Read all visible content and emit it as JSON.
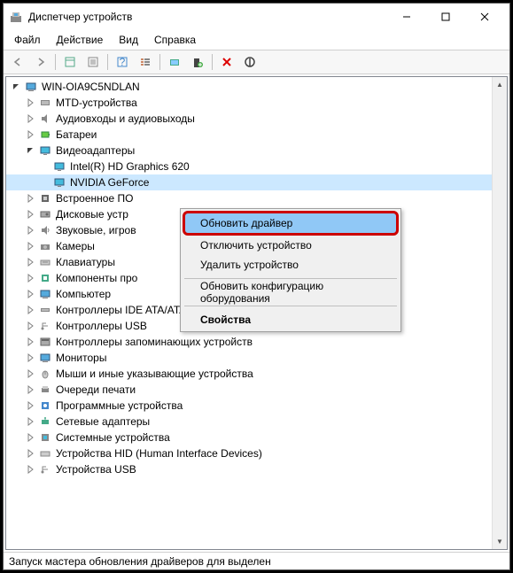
{
  "titlebar": {
    "title": "Диспетчер устройств"
  },
  "menubar": {
    "file": "Файл",
    "action": "Действие",
    "view": "Вид",
    "help": "Справка"
  },
  "tree": {
    "root": "WIN-OIA9C5NDLAN",
    "categories": [
      {
        "label": "MTD-устройства",
        "icon": "mtd"
      },
      {
        "label": "Аудиовходы и аудиовыходы",
        "icon": "audio"
      },
      {
        "label": "Батареи",
        "icon": "battery"
      },
      {
        "label": "Видеоадаптеры",
        "icon": "display",
        "expanded": true,
        "children": [
          {
            "label": "Intel(R) HD Graphics 620"
          },
          {
            "label": "NVIDIA GeForce",
            "selected": true
          }
        ]
      },
      {
        "label": "Встроенное ПО",
        "icon": "firmware"
      },
      {
        "label": "Дисковые устр",
        "icon": "disk"
      },
      {
        "label": "Звуковые, игров",
        "icon": "sound"
      },
      {
        "label": "Камеры",
        "icon": "camera"
      },
      {
        "label": "Клавиатуры",
        "icon": "keyboard"
      },
      {
        "label": "Компоненты про",
        "icon": "component"
      },
      {
        "label": "Компьютер",
        "icon": "computer"
      },
      {
        "label": "Контроллеры IDE ATA/ATAPI",
        "icon": "ide"
      },
      {
        "label": "Контроллеры USB",
        "icon": "usb"
      },
      {
        "label": "Контроллеры запоминающих устройств",
        "icon": "storage"
      },
      {
        "label": "Мониторы",
        "icon": "monitor"
      },
      {
        "label": "Мыши и иные указывающие устройства",
        "icon": "mouse"
      },
      {
        "label": "Очереди печати",
        "icon": "printer"
      },
      {
        "label": "Программные устройства",
        "icon": "software"
      },
      {
        "label": "Сетевые адаптеры",
        "icon": "network"
      },
      {
        "label": "Системные устройства",
        "icon": "system"
      },
      {
        "label": "Устройства HID (Human Interface Devices)",
        "icon": "hid"
      },
      {
        "label": "Устройства USB",
        "icon": "usb2"
      }
    ]
  },
  "context_menu": {
    "update": "Обновить драйвер",
    "disable": "Отключить устройство",
    "remove": "Удалить устройство",
    "refresh": "Обновить конфигурацию оборудования",
    "properties": "Свойства"
  },
  "statusbar": {
    "text": "Запуск мастера обновления драйверов для выделен"
  }
}
